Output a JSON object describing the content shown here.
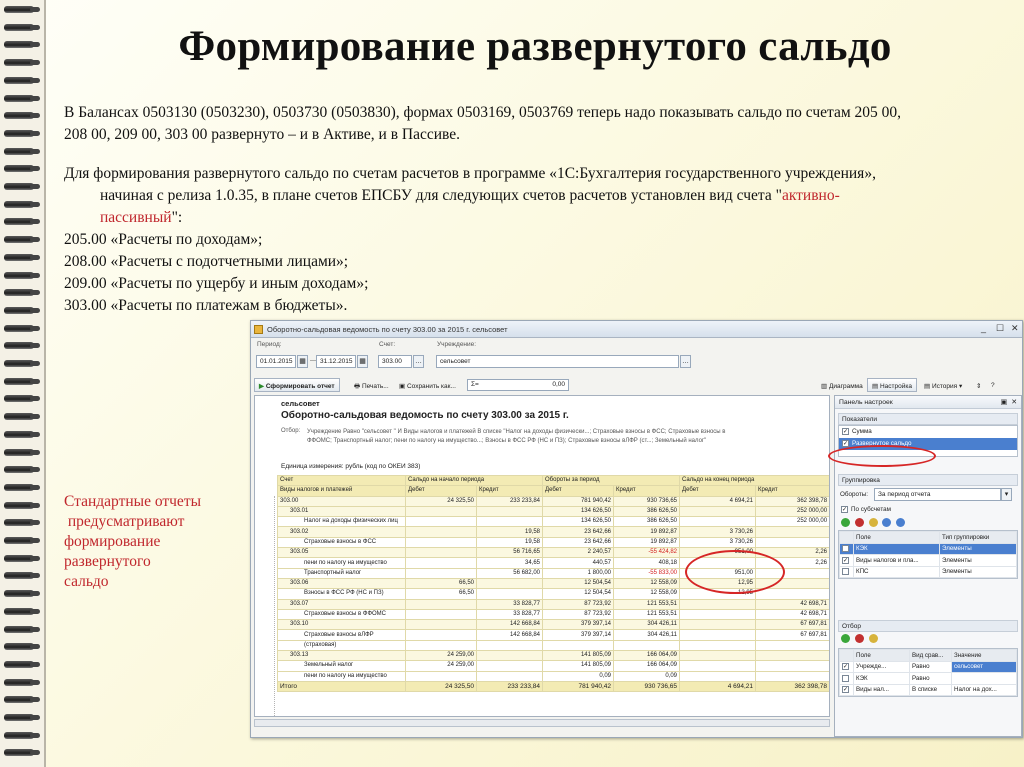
{
  "slide": {
    "title": "Формирование развернутого сальдо",
    "para1_line1": "В Балансах 0503130 (0503230), 0503730 (0503830), формах 0503169, 0503769 теперь надо показывать сальдо по счетам 205 00,",
    "para1_line2": "208 00, 209 00, 303 00 развернуто – и в Активе, и в Пассиве.",
    "para2_line1": "Для формирования развернутого сальдо по счетам расчетов в программе «1С:Бухгалтерия государственного учреждения»,",
    "para2_line2": "начиная с релиза 1.0.35, в плане счетов ЕПСБУ для следующих счетов расчетов установлен вид счета \"",
    "para2_red1": "активно-",
    "para2_red2": "пассивный",
    "para2_end": "\":",
    "accounts": [
      "205.00 «Расчеты по доходам»;",
      "208.00 «Расчеты с подотчетными лицами»;",
      "209.00 «Расчеты по ущербу и иным доходам»;",
      "303.00 «Расчеты по платежам в бюджеты»."
    ],
    "side_note": [
      "Стандартные отчеты",
      " предусматривают",
      "формирование",
      "развернутого",
      "сальдо"
    ]
  },
  "window": {
    "title": "Оборотно-сальдовая ведомость по счету 303.00 за 2015 г. сельсовет",
    "period_label": "Период:",
    "date_from": "01.01.2015",
    "date_to": "31.12.2015",
    "account_label": "Счет:",
    "account_value": "303.00",
    "org_label": "Учреждение:",
    "org_value": "сельсовет",
    "sum_value": "0,00",
    "toolbar": {
      "generate": "Сформировать отчет",
      "print": "Печать...",
      "save_as": "Сохранить как...",
      "chart": "Диаграмма",
      "settings": "Настройка",
      "history": "История"
    },
    "report": {
      "org": "сельсовет",
      "title": "Оборотно-сальдовая ведомость по счету 303.00 за 2015 г.",
      "filter_label": "Отбор:",
      "filter_text": "Учреждение Равно \"сельсовет \" И Виды налогов и платежей В списке \"Налог на доходы физически...; Страховые взносы в ФСС; Страховые взносы в ФФОМС; Транспортный налог; пени по налогу на имущество...; Взносы в ФСС РФ (НС и ПЗ); Страховые взносы вЛФР (ст...; Земельный налог\"",
      "units": "Единица измерения: рубль (код по ОКЕИ 383)",
      "headers": {
        "c1": "Счет",
        "c2": "Сальдо на начало периода",
        "c3": "Обороты за период",
        "c4": "Сальдо на конец периода",
        "sub1": "Виды налогов и платежей",
        "debit": "Дебет",
        "credit": "Кредит"
      },
      "rows": [
        {
          "name": "303.00",
          "lvl": 0,
          "g": true,
          "v": [
            "24 325,50",
            "233 233,84",
            "781 940,42",
            "930 736,65",
            "4 694,21",
            "362 398,78"
          ]
        },
        {
          "name": "303.01",
          "lvl": 1,
          "g": true,
          "v": [
            "",
            "",
            "134 626,50",
            "386 626,50",
            "",
            "252 000,00"
          ]
        },
        {
          "name": "Налог на доходы физических лиц",
          "lvl": 2,
          "g": false,
          "v": [
            "",
            "",
            "134 626,50",
            "386 626,50",
            "",
            "252 000,00"
          ]
        },
        {
          "name": "303.02",
          "lvl": 1,
          "g": true,
          "v": [
            "",
            "19,58",
            "23 642,66",
            "19 892,87",
            "3 730,26",
            ""
          ]
        },
        {
          "name": "Страховые взносы в ФСС",
          "lvl": 2,
          "g": false,
          "v": [
            "",
            "19,58",
            "23 642,66",
            "19 892,87",
            "3 730,26",
            ""
          ]
        },
        {
          "name": "303.05",
          "lvl": 1,
          "g": true,
          "v": [
            "",
            "56 716,65",
            "2 240,57",
            "-55 424,82",
            "951,00",
            "2,26"
          ]
        },
        {
          "name": "пени по налогу на имущество",
          "lvl": 2,
          "g": false,
          "v": [
            "",
            "34,65",
            "440,57",
            "408,18",
            "",
            "2,26"
          ]
        },
        {
          "name": "Транспортный налог",
          "lvl": 2,
          "g": false,
          "v": [
            "",
            "56 682,00",
            "1 800,00",
            "-55 833,00",
            "951,00",
            ""
          ]
        },
        {
          "name": "303.06",
          "lvl": 1,
          "g": true,
          "v": [
            "66,50",
            "",
            "12 504,54",
            "12 558,09",
            "12,95",
            ""
          ]
        },
        {
          "name": "Взносы в ФСС РФ (НС и ПЗ)",
          "lvl": 2,
          "g": false,
          "v": [
            "66,50",
            "",
            "12 504,54",
            "12 558,09",
            "12,95",
            ""
          ]
        },
        {
          "name": "303.07",
          "lvl": 1,
          "g": true,
          "v": [
            "",
            "33 828,77",
            "87 723,92",
            "121 553,51",
            "",
            "42 698,71"
          ]
        },
        {
          "name": "Страховые взносы в ФФОМС",
          "lvl": 2,
          "g": false,
          "v": [
            "",
            "33 828,77",
            "87 723,92",
            "121 553,51",
            "",
            "42 698,71"
          ]
        },
        {
          "name": "303.10",
          "lvl": 1,
          "g": true,
          "v": [
            "",
            "142 668,84",
            "379 397,14",
            "304 426,11",
            "",
            "67 697,81"
          ]
        },
        {
          "name": "Страховые взносы вЛФР",
          "lvl": 2,
          "g": false,
          "v": [
            "",
            "142 668,84",
            "379 397,14",
            "304 426,11",
            "",
            "67 697,81"
          ]
        },
        {
          "name": "(страховая)",
          "lvl": 2,
          "g": false,
          "v": [
            "",
            "",
            "",
            "",
            "",
            ""
          ]
        },
        {
          "name": "303.13",
          "lvl": 1,
          "g": true,
          "v": [
            "24 259,00",
            "",
            "141 805,09",
            "166 064,09",
            "",
            ""
          ]
        },
        {
          "name": "Земельный налог",
          "lvl": 2,
          "g": false,
          "v": [
            "24 259,00",
            "",
            "141 805,09",
            "166 064,09",
            "",
            ""
          ]
        },
        {
          "name": "пени по налогу на имущество",
          "lvl": 2,
          "g": false,
          "v": [
            "",
            "",
            "0,09",
            "0,09",
            "",
            ""
          ]
        }
      ],
      "total": {
        "name": "Итого",
        "v": [
          "24 325,50",
          "233 233,84",
          "781 940,42",
          "930 736,65",
          "4 694,21",
          "362 398,78"
        ]
      }
    },
    "panel": {
      "title": "Панель настроек",
      "indicators_label": "Показатели",
      "indicators": [
        {
          "label": "Сумма",
          "checked": true
        },
        {
          "label": "Развернутое сальдо",
          "checked": true
        }
      ],
      "grouping_label": "Группировка",
      "turnover_label": "Обороты:",
      "turnover_value": "За период отчета",
      "by_subaccounts": "По субсчетам",
      "group_cols": [
        "Поле",
        "Тип группировки"
      ],
      "group_rows": [
        [
          "КЭК",
          "Элементы"
        ],
        [
          "Виды налогов и пла...",
          "Элементы"
        ],
        [
          "КПС",
          "Элементы"
        ]
      ],
      "filter_label": "Отбор",
      "filter_cols": [
        "Поле",
        "Вид срав...",
        "Значение"
      ],
      "filter_rows": [
        [
          "Учрежде...",
          "Равно",
          "сельсовет"
        ],
        [
          "КЭК",
          "Равно",
          ""
        ],
        [
          "Виды нал...",
          "В списке",
          "Налог на дох..."
        ]
      ]
    }
  }
}
